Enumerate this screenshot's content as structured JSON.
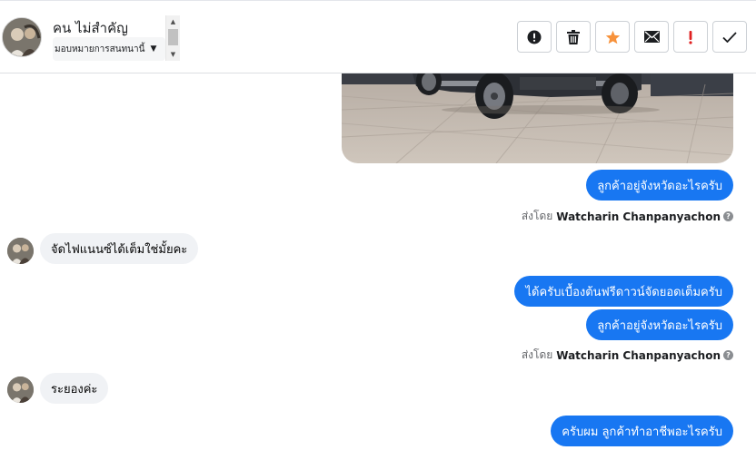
{
  "header": {
    "contact_name": "คน ไม่สำคัญ",
    "assign_label": "มอบหมายการสนทนานี้",
    "actions": [
      {
        "name": "spam-button",
        "icon": "alert-circle-icon"
      },
      {
        "name": "delete-button",
        "icon": "trash-icon"
      },
      {
        "name": "star-button",
        "icon": "star-icon"
      },
      {
        "name": "mark-unread-button",
        "icon": "envelope-icon"
      },
      {
        "name": "important-button",
        "icon": "exclamation-icon"
      },
      {
        "name": "done-button",
        "icon": "checkmark-icon"
      }
    ]
  },
  "messages": {
    "m1": "ลูกค้าอยู่จังหวัดอะไรครับ",
    "sent_by_1": {
      "prefix": "ส่งโดย",
      "name": "Watcharin Chanpanyachon"
    },
    "m2": "จัดไฟแนนซ์ได้เต็มใช่มั้ยคะ",
    "m3": "ได้ครับเบื้องต้นฟรีดาวน์จัดยอดเต็มครับ",
    "m4": "ลูกค้าอยู่จังหวัดอะไรครับ",
    "sent_by_2": {
      "prefix": "ส่งโดย",
      "name": "Watcharin Chanpanyachon"
    },
    "m5": "ระยองค่ะ",
    "m6": "ครับผม ลูกค้าทำอาชีพอะไรครับ"
  },
  "colors": {
    "outgoing_bubble": "#1877f2",
    "incoming_bubble": "#f0f2f5",
    "star": "#f7923b",
    "important": "#e02020"
  }
}
